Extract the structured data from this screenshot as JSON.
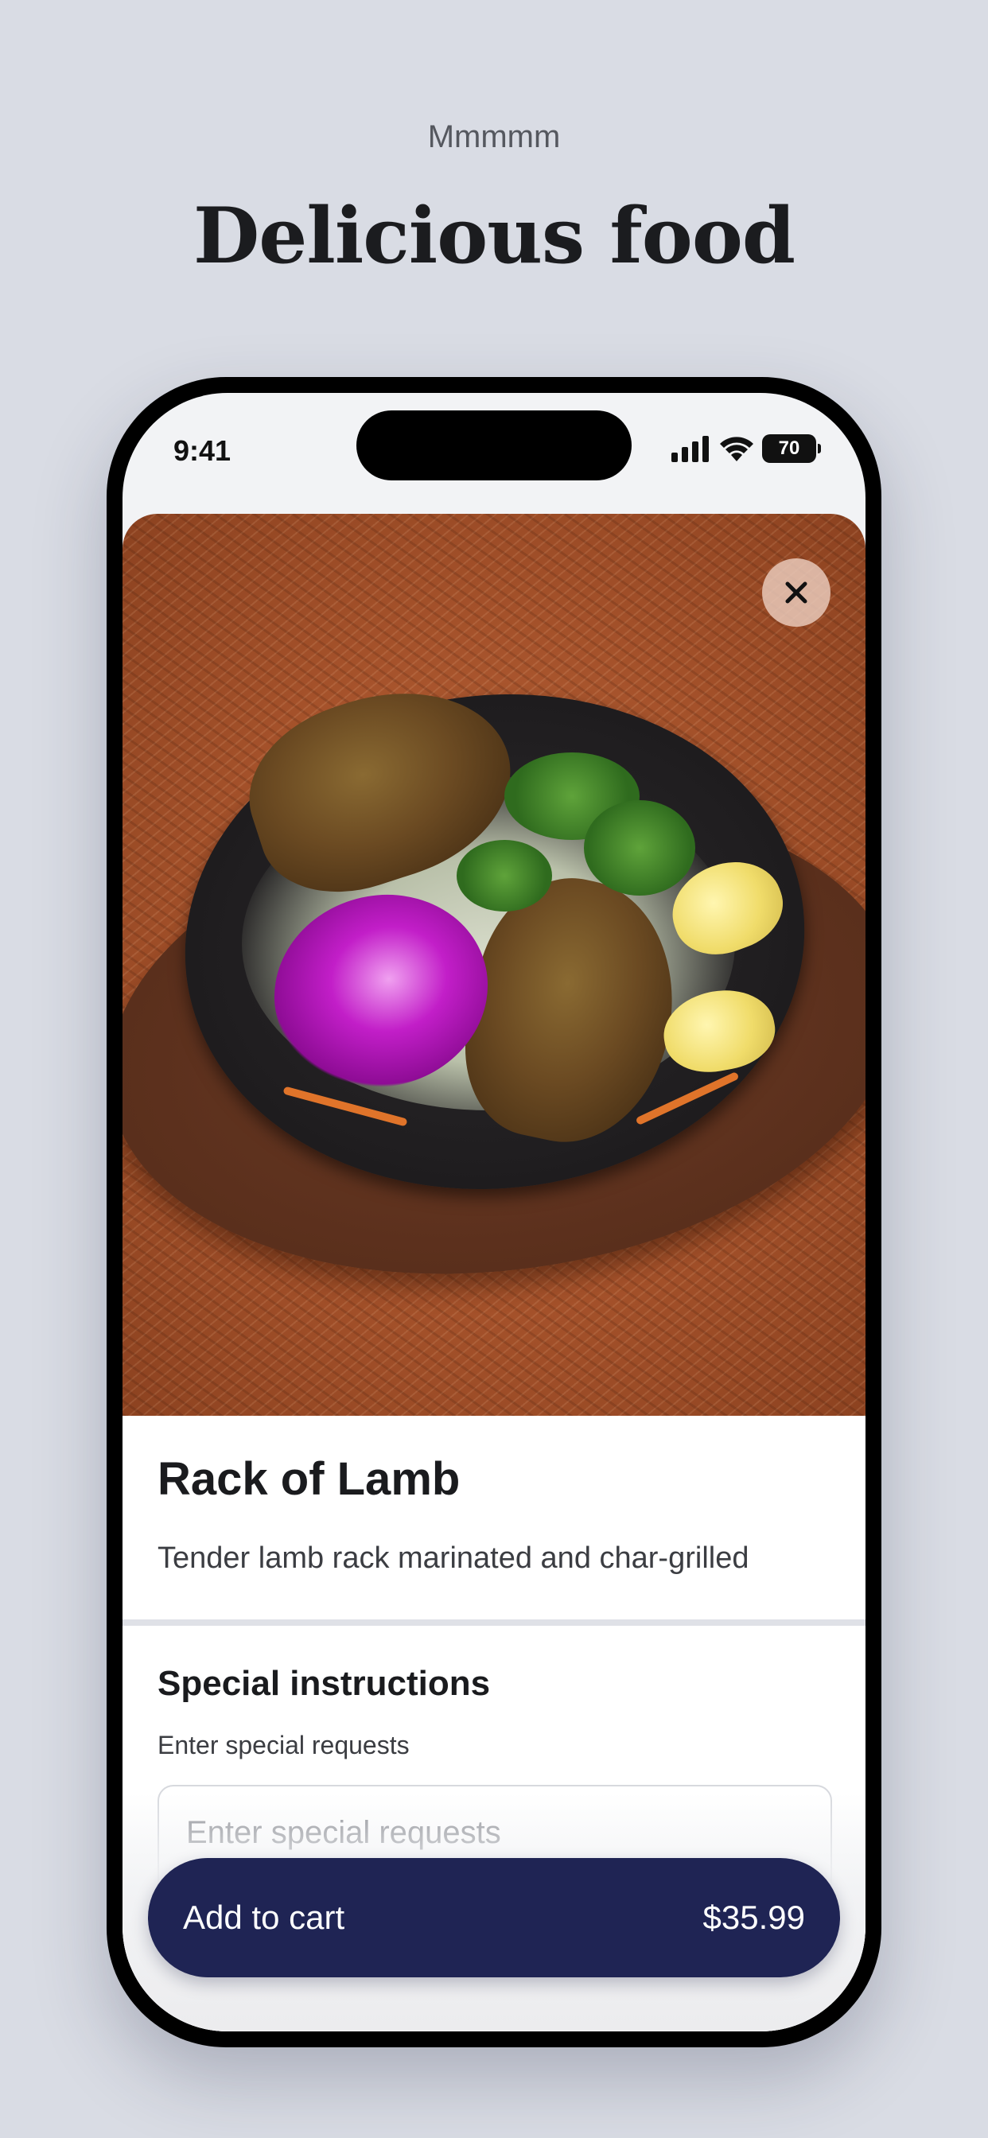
{
  "header": {
    "kicker": "Mmmmm",
    "headline": "Delicious food"
  },
  "status_bar": {
    "time": "9:41",
    "battery": "70",
    "icons": [
      "signal-icon",
      "wifi-icon",
      "battery-icon"
    ]
  },
  "item": {
    "image_icon": "food-photo",
    "close_icon": "close-icon",
    "title": "Rack of Lamb",
    "description": "Tender lamb rack marinated and char-grilled"
  },
  "special_instructions": {
    "heading": "Special instructions",
    "label": "Enter special requests",
    "placeholder": "Enter special requests",
    "value": ""
  },
  "cart": {
    "label": "Add to cart",
    "price": "$35.99"
  },
  "colors": {
    "background": "#d9dce4",
    "cart_button": "#1f2454"
  }
}
